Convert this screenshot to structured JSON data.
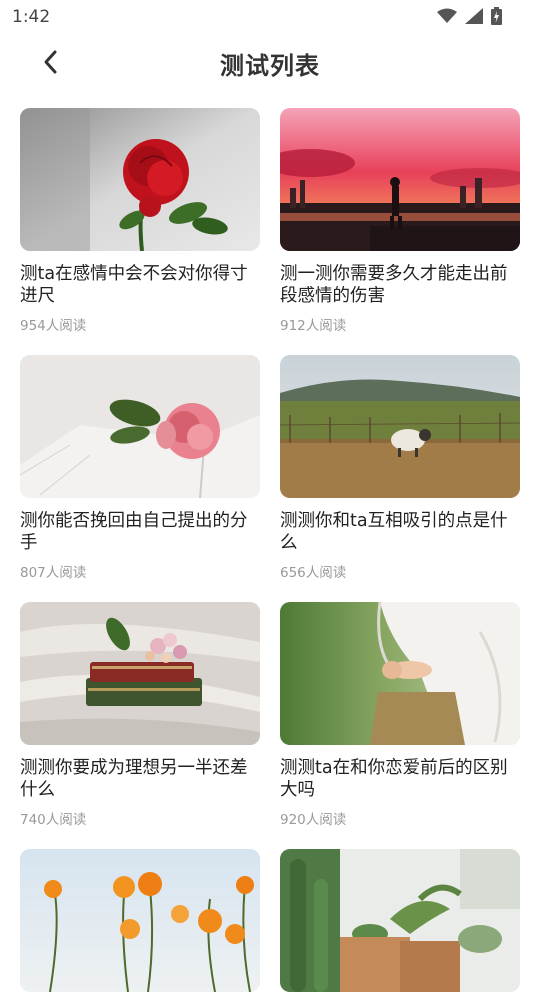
{
  "status": {
    "time": "1:42"
  },
  "header": {
    "title": "测试列表"
  },
  "cards": [
    {
      "title": "测ta在感情中会不会对你得寸进尺",
      "reads": "954人阅读"
    },
    {
      "title": "测一测你需要多久才能走出前段感情的伤害",
      "reads": "912人阅读"
    },
    {
      "title": "测你能否挽回由自己提出的分手",
      "reads": "807人阅读"
    },
    {
      "title": "测测你和ta互相吸引的点是什么",
      "reads": "656人阅读"
    },
    {
      "title": "测测你要成为理想另一半还差什么",
      "reads": "740人阅读"
    },
    {
      "title": "测测ta在和你恋爱前后的区别大吗",
      "reads": "920人阅读"
    },
    {
      "title": "",
      "reads": ""
    },
    {
      "title": "",
      "reads": ""
    }
  ]
}
